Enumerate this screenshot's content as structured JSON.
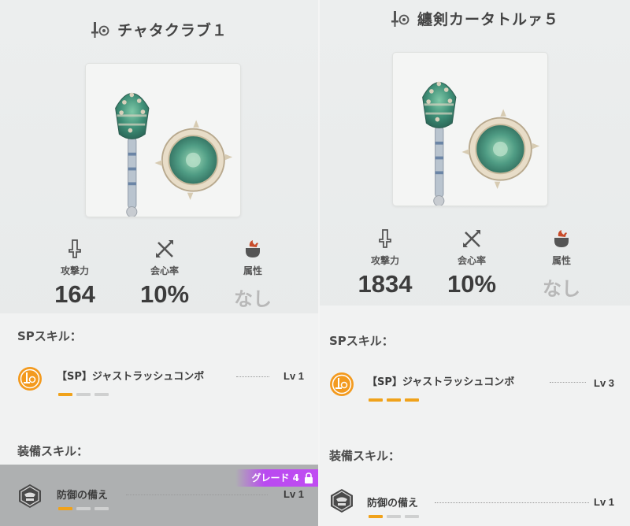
{
  "left": {
    "title": "チャタクラブ１",
    "stats": [
      {
        "icon": "sword-icon",
        "label": "攻撃力",
        "value": "164"
      },
      {
        "icon": "affinity-icon",
        "label": "会心率",
        "value": "10%"
      },
      {
        "icon": "element-icon",
        "label": "属性",
        "value": "なし"
      }
    ],
    "sp_title": "SPスキル：",
    "sp_skill": {
      "name": "【SP】ジャストラッシュコンボ",
      "level": "Lv 1",
      "filled": 1
    },
    "equip_title": "装備スキル：",
    "equip_skill": {
      "name": "防御の備え",
      "level": "Lv 1",
      "filled": 1
    },
    "grade_badge": "グレード 4"
  },
  "right": {
    "title": "纏剣カータトルァ５",
    "stats": [
      {
        "icon": "sword-icon",
        "label": "攻撃力",
        "value": "1834"
      },
      {
        "icon": "affinity-icon",
        "label": "会心率",
        "value": "10%"
      },
      {
        "icon": "element-icon",
        "label": "属性",
        "value": "なし"
      }
    ],
    "sp_title": "SPスキル：",
    "sp_skill": {
      "name": "【SP】ジャストラッシュコンボ",
      "level": "Lv 3",
      "filled": 3
    },
    "equip_title": "装備スキル：",
    "equip_skill": {
      "name": "防御の備え",
      "level": "Lv 1",
      "filled": 1
    }
  },
  "colors": {
    "accent": "#f0a21b",
    "grade": "#b94af0",
    "sp_icon": "#f39a1e"
  }
}
